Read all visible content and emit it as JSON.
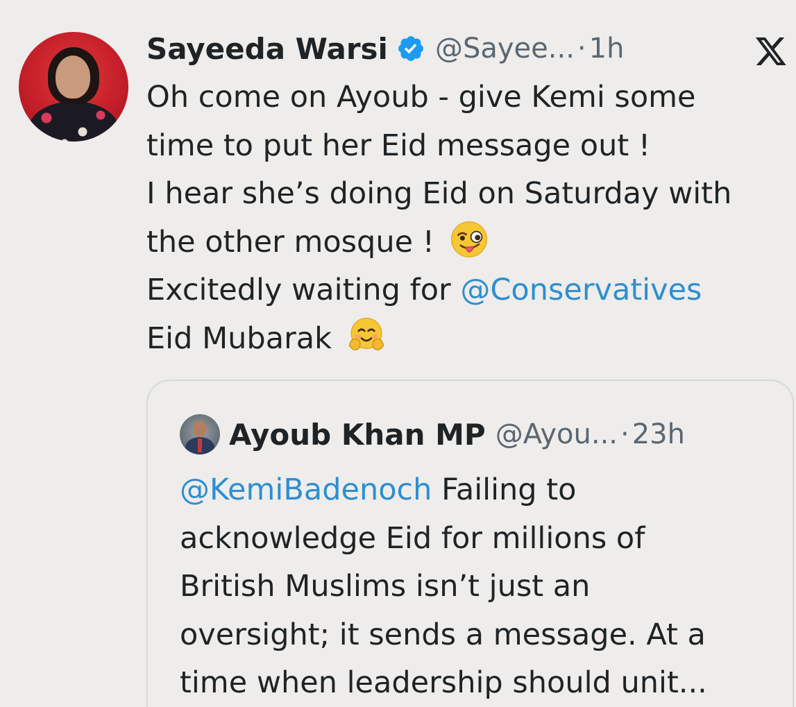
{
  "tweet": {
    "author": {
      "name": "Sayeeda Warsi",
      "handle": "@Sayee...",
      "verified": true,
      "avatar_icon": "user-avatar-photo"
    },
    "separator": "·",
    "time": "1h",
    "platform_icon": "x-logo-icon",
    "body": {
      "line1": "Oh come on Ayoub - give Kemi some",
      "line2": "time to put her Eid message out !",
      "line3": "I hear she’s doing Eid on Saturday with",
      "line4": "the other mosque !",
      "line4_emoji": "winking-face-with-tongue",
      "line5_prefix": "Excitedly waiting for ",
      "line5_mention": "@Conservatives",
      "line6": "Eid Mubarak",
      "line6_emoji": "smiling-face-with-open-hands"
    },
    "colors": {
      "background": "#eeedeb",
      "text": "#1f2326",
      "secondary_text": "#5b6670",
      "mention": "#2d8ed0",
      "verified_badge": "#1d9bf0"
    }
  },
  "quoted_tweet": {
    "author": {
      "name": "Ayoub Khan MP",
      "handle": "@Ayou...",
      "avatar_icon": "user-avatar-photo"
    },
    "separator": "·",
    "time": "23h",
    "body": {
      "line1_mention": "@KemiBadenoch",
      "line1_rest": " Failing to",
      "line2": "acknowledge Eid for millions of",
      "line3": "British Muslims isn’t just an",
      "line4": "oversight; it sends a message. At a",
      "line5": "time when leadership should unit..."
    }
  }
}
